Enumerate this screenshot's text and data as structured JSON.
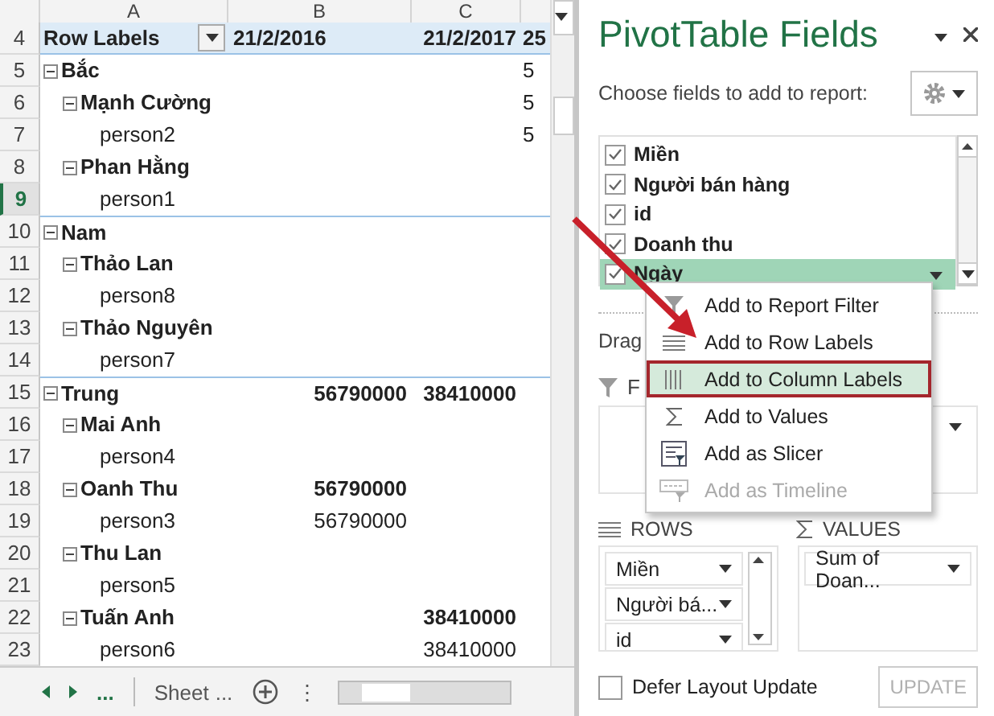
{
  "sheet": {
    "column_headers": [
      "A",
      "B",
      "C"
    ],
    "header_row": {
      "row_number": "4",
      "cells": [
        "Row Labels",
        "21/2/2016",
        "21/2/2017",
        "25"
      ]
    },
    "rows": [
      {
        "row_number": "5",
        "label": "Bắc",
        "expanded": true,
        "selected": false,
        "column_d": "5",
        "children": [
          {
            "row_number": "6",
            "label": "Mạnh Cường",
            "expanded": true,
            "selected": false,
            "column_d": "5",
            "children": [
              {
                "row_number": "7",
                "label": "person2",
                "selected": false,
                "column_d": "5"
              }
            ]
          },
          {
            "row_number": "8",
            "label": "Phan Hằng",
            "expanded": true,
            "selected": false,
            "children": [
              {
                "row_number": "9",
                "label": "person1",
                "selected": true
              }
            ]
          }
        ]
      },
      {
        "row_number": "10",
        "label": "Nam",
        "expanded": true,
        "selected": false,
        "children": [
          {
            "row_number": "11",
            "label": "Thảo Lan",
            "expanded": true,
            "selected": false,
            "children": [
              {
                "row_number": "12",
                "label": "person8",
                "selected": false
              }
            ]
          },
          {
            "row_number": "13",
            "label": "Thảo Nguyên",
            "expanded": true,
            "selected": false,
            "children": [
              {
                "row_number": "14",
                "label": "person7",
                "selected": false
              }
            ]
          }
        ]
      },
      {
        "row_number": "15",
        "label": "Trung",
        "expanded": true,
        "selected": false,
        "column_b": "56790000",
        "column_c": "38410000",
        "children": [
          {
            "row_number": "16",
            "label": "Mai Anh",
            "expanded": true,
            "selected": false,
            "children": [
              {
                "row_number": "17",
                "label": "person4",
                "selected": false
              }
            ]
          },
          {
            "row_number": "18",
            "label": "Oanh Thu",
            "expanded": true,
            "selected": false,
            "column_b": "56790000",
            "children": [
              {
                "row_number": "19",
                "label": "person3",
                "selected": false,
                "column_b": "56790000"
              }
            ]
          },
          {
            "row_number": "20",
            "label": "Thu Lan",
            "expanded": true,
            "selected": false,
            "children": [
              {
                "row_number": "21",
                "label": "person5",
                "selected": false
              }
            ]
          },
          {
            "row_number": "22",
            "label": "Tuấn Anh",
            "expanded": true,
            "selected": false,
            "column_c": "38410000",
            "children": [
              {
                "row_number": "23",
                "label": "person6",
                "selected": false,
                "column_c": "38410000"
              }
            ]
          }
        ]
      }
    ]
  },
  "sheet_tabs": {
    "more_left": "...",
    "tab": "Sheet",
    "more_right": "...",
    "options": "⋮"
  },
  "pane": {
    "title": "PivotTable Fields",
    "choose_label": "Choose fields to add to report:",
    "fields": [
      {
        "label": "Miền",
        "checked": true,
        "selected": false
      },
      {
        "label": "Người bán hàng",
        "checked": true,
        "selected": false
      },
      {
        "label": "id",
        "checked": true,
        "selected": false
      },
      {
        "label": "Doanh thu",
        "checked": true,
        "selected": false
      },
      {
        "label": "Ngày",
        "checked": true,
        "selected": true
      }
    ],
    "drag_label": "Drag",
    "filters_label": "F",
    "rows_label": "ROWS",
    "values_label": "VALUES",
    "rows": [
      "Miền",
      "Người bá...",
      "id"
    ],
    "values": [
      "Sum of Doan..."
    ],
    "defer": {
      "label": "Defer Layout Update",
      "checked": false
    },
    "update_button": {
      "label": "UPDATE",
      "disabled": true
    }
  },
  "context_menu": [
    {
      "kind": "filter",
      "label": "Add to Report Filter",
      "selected": false,
      "disabled": false
    },
    {
      "kind": "rows",
      "label": "Add to Row Labels",
      "selected": false,
      "disabled": false
    },
    {
      "kind": "columns",
      "label": "Add to Column Labels",
      "selected": true,
      "disabled": false
    },
    {
      "kind": "values",
      "label": "Add to Values",
      "selected": false,
      "disabled": false
    },
    {
      "kind": "slicer",
      "label": "Add as Slicer",
      "selected": false,
      "disabled": false
    },
    {
      "kind": "timeline",
      "label": "Add as Timeline",
      "selected": false,
      "disabled": true
    }
  ]
}
